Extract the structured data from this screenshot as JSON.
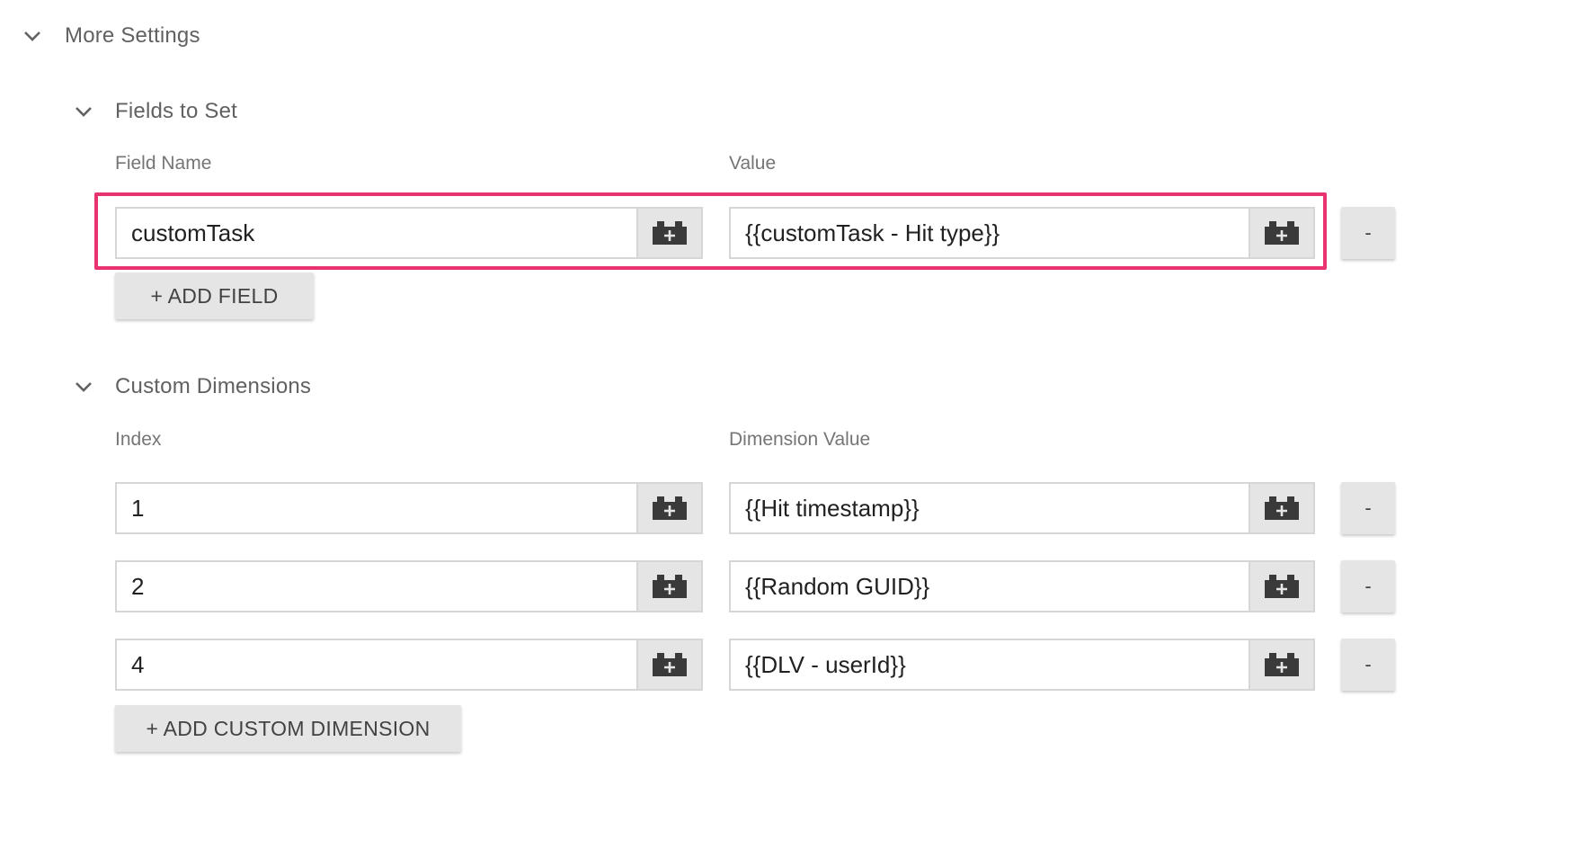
{
  "more_settings": {
    "title": "More Settings"
  },
  "fields_to_set": {
    "title": "Fields to Set",
    "col_name_label": "Field Name",
    "col_value_label": "Value",
    "rows": [
      {
        "name": "customTask",
        "value": "{{customTask - Hit type}}",
        "remove_label": "-"
      }
    ],
    "add_label": "+ ADD FIELD",
    "highlight_color": "#e8336e"
  },
  "custom_dimensions": {
    "title": "Custom Dimensions",
    "col_index_label": "Index",
    "col_value_label": "Dimension Value",
    "rows": [
      {
        "index": "1",
        "value": "{{Hit timestamp}}",
        "remove_label": "-"
      },
      {
        "index": "2",
        "value": "{{Random GUID}}",
        "remove_label": "-"
      },
      {
        "index": "4",
        "value": "{{DLV - userId}}",
        "remove_label": "-"
      }
    ],
    "add_label": "+ ADD CUSTOM DIMENSION"
  },
  "icons": {
    "chevron": "chevron-down-icon",
    "variable": "variable-brick-icon"
  }
}
